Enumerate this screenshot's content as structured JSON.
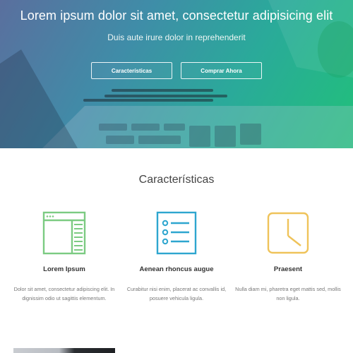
{
  "hero": {
    "title": "Lorem ipsum dolor sit amet, consectetur adipisicing elit",
    "subtitle": "Duis aute irure dolor in reprehenderit",
    "buttons": [
      {
        "label": "Características"
      },
      {
        "label": "Comprar Ahora"
      }
    ]
  },
  "features": {
    "title": "Características",
    "items": [
      {
        "icon": "browser-window-icon",
        "color": "#7ccb82",
        "title": "Lorem Ipsum",
        "text": "Dolor sit amet, consectetur adipiscing elit. In dignissim odio ut sagittis elementum."
      },
      {
        "icon": "checklist-icon",
        "color": "#2ea6cf",
        "title": "Aenean rhoncus augue",
        "text": "Curabitur nisi enim, placerat ac convallis id, posuere vehicula ligula."
      },
      {
        "icon": "clock-icon",
        "color": "#efc35a",
        "title": "Praesent",
        "text": "Nulla diam mi, pharetra eget mattis sed, mollis non ligula."
      }
    ]
  }
}
